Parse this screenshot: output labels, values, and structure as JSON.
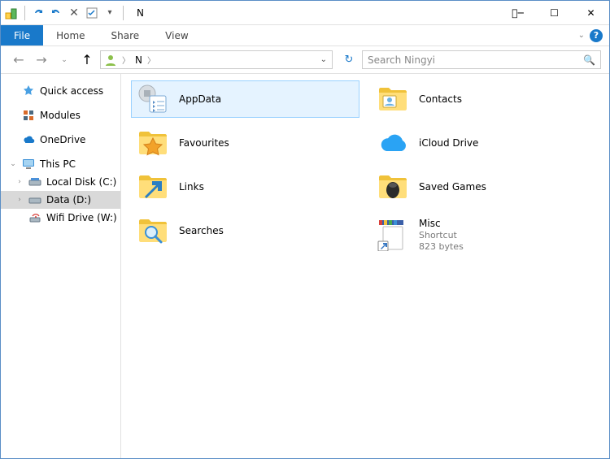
{
  "window": {
    "title": "N"
  },
  "menu": {
    "file": "File",
    "home": "Home",
    "share": "Share",
    "view": "View"
  },
  "nav": {
    "current_crumb": "N",
    "search_placeholder": "Search Ningyi"
  },
  "sidebar": {
    "quick_access": "Quick access",
    "modules": "Modules",
    "onedrive": "OneDrive",
    "this_pc": "This PC",
    "local_disk": "Local Disk (C:)",
    "data": "Data (D:)",
    "wifi_drive": "Wifi Drive (W:)"
  },
  "items": {
    "appdata": "AppData",
    "contacts": "Contacts",
    "favourites": "Favourites",
    "icloud": "iCloud Drive",
    "links": "Links",
    "saved_games": "Saved Games",
    "searches": "Searches",
    "misc": {
      "name": "Misc",
      "type": "Shortcut",
      "size": "823 bytes"
    }
  }
}
